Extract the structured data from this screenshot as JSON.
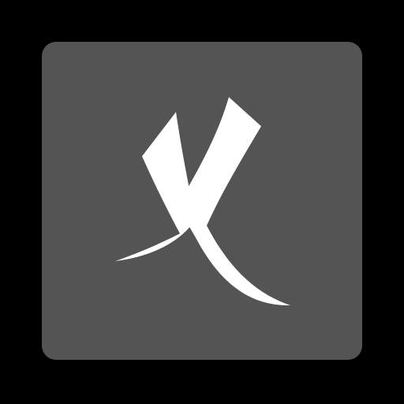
{
  "icon": {
    "name": "x-swoosh-logo-icon",
    "tile_color": "#545454",
    "glyph_color": "#ffffff",
    "background_color": "#000000"
  }
}
